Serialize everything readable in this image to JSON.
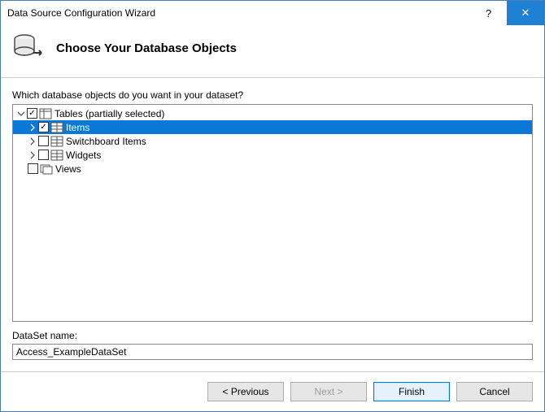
{
  "window": {
    "title": "Data Source Configuration Wizard",
    "help_symbol": "?",
    "close_symbol": "✕"
  },
  "header": {
    "title": "Choose Your Database Objects"
  },
  "question": "Which database objects do you want in your dataset?",
  "tree": {
    "tables_label": "Tables (partially selected)",
    "items_label": "Items",
    "switchboard_label": "Switchboard Items",
    "widgets_label": "Widgets",
    "views_label": "Views"
  },
  "dataset": {
    "label": "DataSet name:",
    "value": "Access_ExampleDataSet"
  },
  "buttons": {
    "previous": "< Previous",
    "next": "Next >",
    "finish": "Finish",
    "cancel": "Cancel"
  }
}
